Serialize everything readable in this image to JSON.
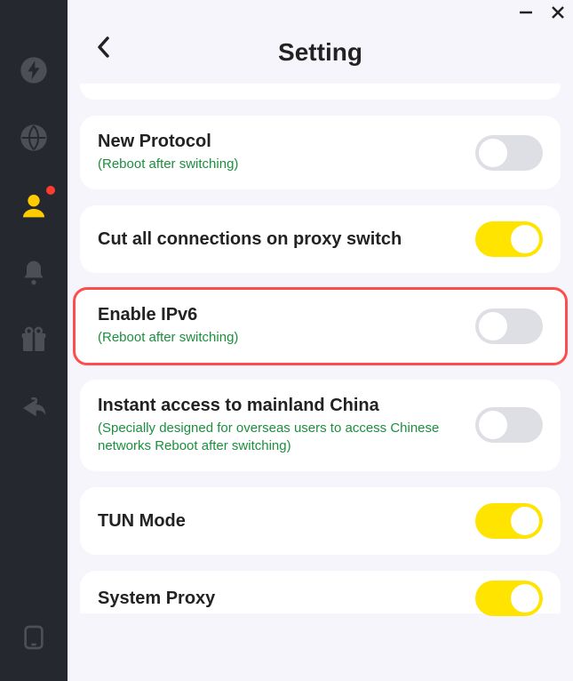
{
  "page": {
    "title": "Setting"
  },
  "settings": [
    {
      "title": "New Protocol",
      "note": "(Reboot after switching)",
      "state": false,
      "highlight": false
    },
    {
      "title": "Cut all connections on proxy switch",
      "note": "",
      "state": true,
      "highlight": false
    },
    {
      "title": "Enable IPv6",
      "note": "(Reboot after switching)",
      "state": false,
      "highlight": true
    },
    {
      "title": "Instant access to mainland China",
      "note": "(Specially designed for overseas users to access Chinese networks Reboot after switching)",
      "state": false,
      "highlight": false
    },
    {
      "title": "TUN Mode",
      "note": "",
      "state": true,
      "highlight": false
    },
    {
      "title": "System Proxy",
      "note": "",
      "state": true,
      "highlight": false,
      "partial": true
    }
  ],
  "sidebar": {
    "items": [
      {
        "name": "speed",
        "active": false
      },
      {
        "name": "globe",
        "active": false
      },
      {
        "name": "user",
        "active": true
      },
      {
        "name": "bell",
        "active": false
      },
      {
        "name": "gift",
        "active": false
      },
      {
        "name": "share",
        "active": false
      }
    ]
  }
}
